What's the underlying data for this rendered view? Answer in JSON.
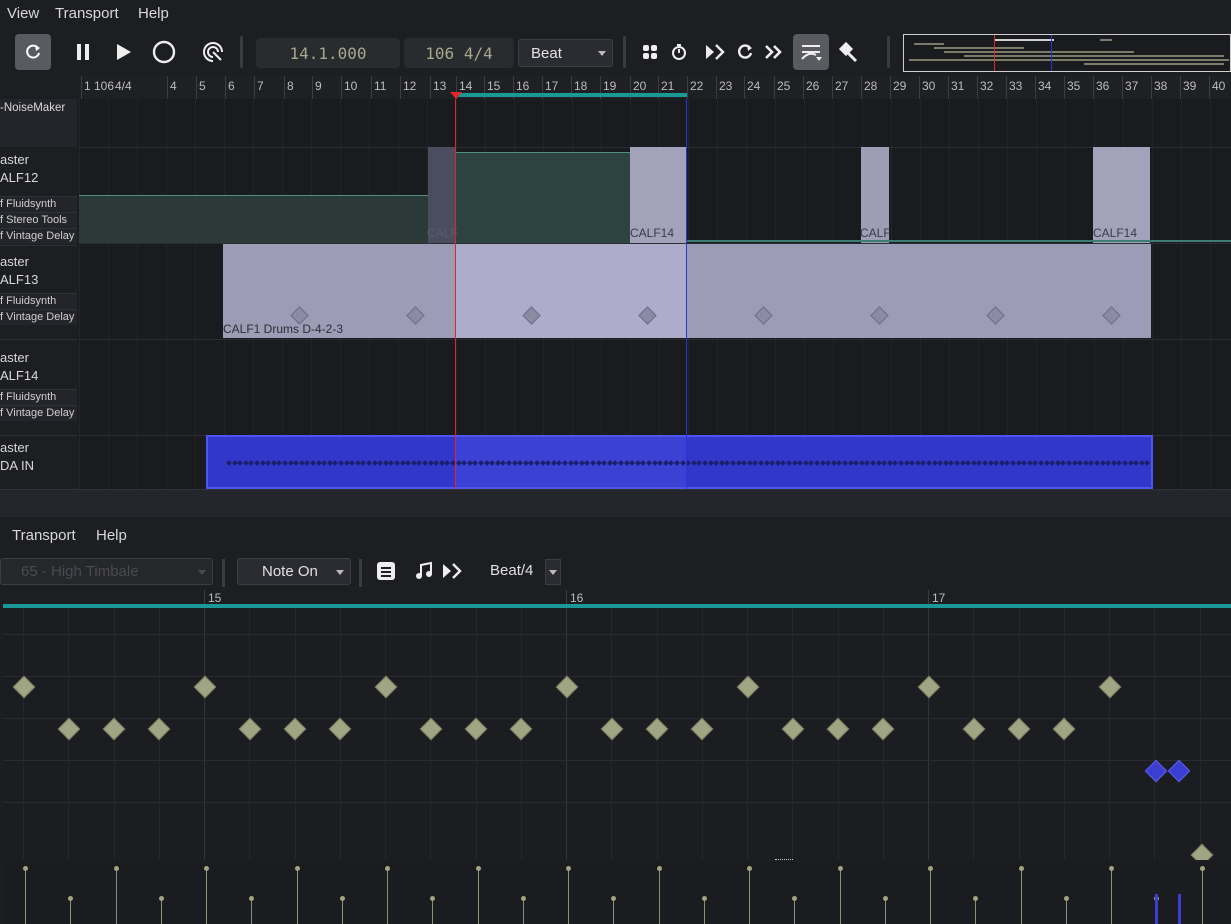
{
  "menubar": {
    "items": [
      "View",
      "Transport",
      "Help"
    ]
  },
  "toolbar": {
    "position": "14.1.000",
    "tempo_sig": "106 4/4",
    "snap": "Beat",
    "icons": [
      "loop-icon",
      "pause-icon",
      "play-icon",
      "record-icon",
      "punch-icon",
      "snap-grid-icon",
      "metronome-icon",
      "follow-icon",
      "repeat-icon",
      "fast-forward-icon",
      "automation-icon",
      "tools-icon"
    ]
  },
  "ruler": {
    "labels": [
      "1",
      "106",
      "4/4",
      "4",
      "5",
      "6",
      "7",
      "8",
      "9",
      "10",
      "11",
      "12",
      "13",
      "14",
      "15",
      "16",
      "17",
      "18",
      "19",
      "20",
      "21",
      "22",
      "23",
      "24",
      "25",
      "26",
      "27",
      "28",
      "29",
      "30",
      "31",
      "32",
      "33",
      "34",
      "35",
      "36",
      "37",
      "38",
      "39",
      "40"
    ]
  },
  "tracks": {
    "t0": {
      "name": "-NoiseMaker"
    },
    "t1": {
      "name1": "aster",
      "name2": "ALF12",
      "plugins": [
        "f Fluidsynth",
        "f Stereo Tools",
        "f Vintage Delay"
      ]
    },
    "t2": {
      "name1": "aster",
      "name2": "ALF13",
      "plugins": [
        "f Fluidsynth",
        "f Vintage Delay"
      ]
    },
    "t3": {
      "name1": "aster",
      "name2": "ALF14",
      "plugins": [
        "f Fluidsynth",
        "f Vintage Delay"
      ]
    },
    "t4": {
      "name1": "aster",
      "name2": "DA IN"
    }
  },
  "regions": {
    "r1": "CALF",
    "r2": "CALF14",
    "r3": "CALF",
    "r4": "CALF14",
    "drums": "CALF1 Drums D-4-2-3"
  },
  "editor": {
    "menu": [
      "Transport",
      "Help"
    ],
    "instrument_select": "65 - High Timbale",
    "event_type": "Note On",
    "snap": "Beat/4",
    "bar_labels": [
      "15",
      "16",
      "17"
    ],
    "icons": [
      "list-icon",
      "note-icon",
      "follow-icon"
    ]
  },
  "colors": {
    "accent": "#1a9a96",
    "playhead": "#e0262a",
    "loop_end": "#2a37d8",
    "region": "#a9a8c8",
    "midi_region": "#3a3fd2",
    "note": "#a1a583"
  }
}
